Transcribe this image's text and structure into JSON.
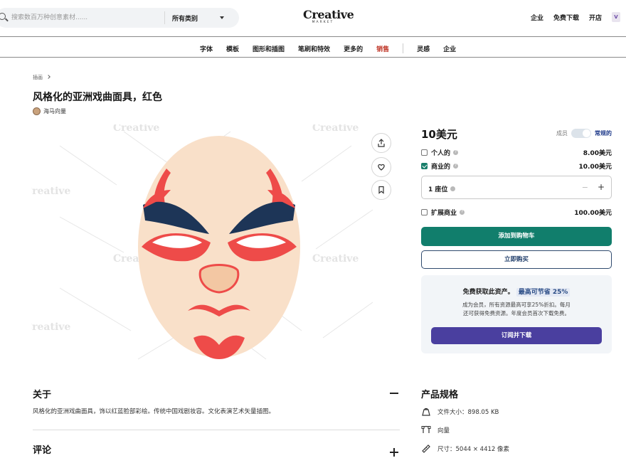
{
  "header": {
    "search_placeholder": "搜索数百万种创意素材......",
    "category_select": "所有类别",
    "logo_line1": "Creative",
    "logo_line2": "MARKET",
    "links": [
      "企业",
      "免费下载",
      "开店"
    ],
    "avatar_letter": "V"
  },
  "nav": {
    "items": [
      "字体",
      "模板",
      "图形和插图",
      "笔刷和特效",
      "更多的",
      "销售",
      "灵感",
      "企业"
    ]
  },
  "breadcrumb": "插画",
  "product": {
    "title": "风格化的亚洲戏曲面具，红色",
    "author": "海马向量"
  },
  "purchase": {
    "price": "10美元",
    "toggle_left": "成员",
    "toggle_right": "常规的",
    "options": [
      {
        "label": "个人的",
        "price": "8.00美元",
        "checked": false
      },
      {
        "label": "商业的",
        "price": "10.00美元",
        "checked": true
      },
      {
        "label": "扩展商业",
        "price": "100.00美元",
        "checked": false
      }
    ],
    "seats_label": "1 座位",
    "seats_minus": "−",
    "seats_plus": "+",
    "add_to_cart": "添加到购物车",
    "buy_now": "立即购买"
  },
  "promo": {
    "headline": "免费获取此资产。",
    "headline_badge": "最高可节省 25%",
    "desc1": "成为会员，所有资源最高可享25%折扣。每月",
    "desc2": "还可获得免费资源。年度会员首次下载免费。",
    "button": "订阅并下载"
  },
  "about": {
    "heading": "关于",
    "body": "风格化的亚洲戏曲面具，饰以红蓝脸部彩绘。传统中国戏剧妆容。文化表演艺术矢量插图。"
  },
  "reviews": {
    "heading": "评论"
  },
  "specs": {
    "heading": "产品规格",
    "items": [
      "文件大小：898.05 KB",
      "向量",
      "尺寸：5044 × 4412 像素"
    ]
  },
  "watermark": "Creative"
}
